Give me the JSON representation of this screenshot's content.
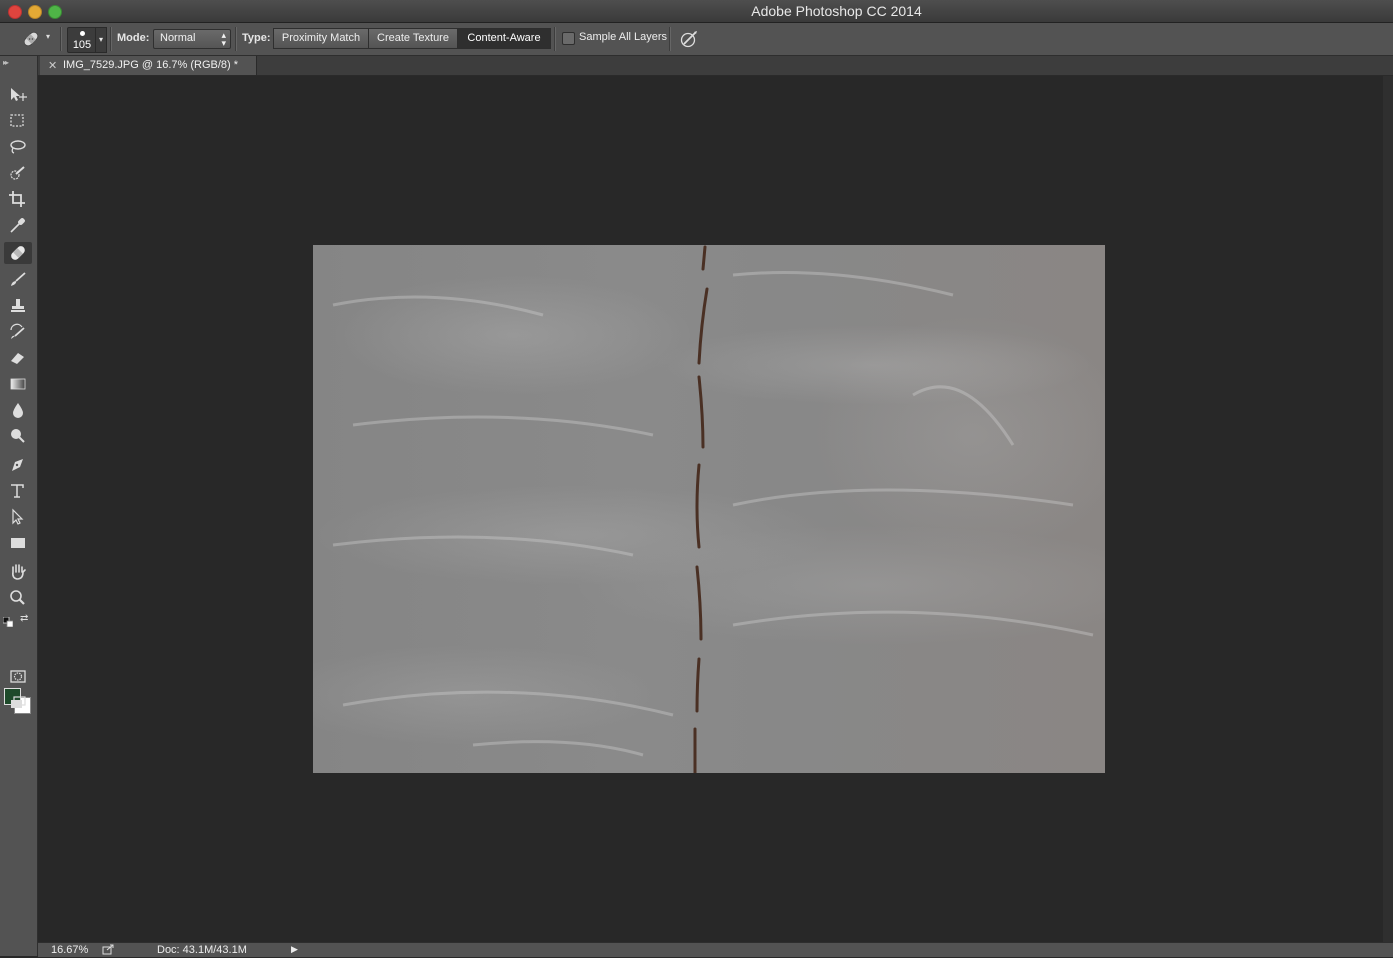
{
  "window": {
    "title": "Adobe Photoshop CC 2014"
  },
  "options_bar": {
    "brush_size": "105",
    "mode_label": "Mode:",
    "mode_value": "Normal",
    "type_label": "Type:",
    "type_options": [
      "Proximity Match",
      "Create Texture",
      "Content-Aware"
    ],
    "type_selected": "Content-Aware",
    "sample_all_layers_label": "Sample All Layers",
    "sample_all_layers_checked": false
  },
  "toolbar": {
    "active_tool": "spot-healing-brush-tool",
    "tools": [
      "move-tool-icon",
      "marquee-tool-icon",
      "lasso-tool-icon",
      "quick-selection-tool-icon",
      "crop-tool-icon",
      "eyedropper-tool-icon",
      "spot-healing-brush-tool-icon",
      "brush-tool-icon",
      "clone-stamp-tool-icon",
      "history-brush-tool-icon",
      "eraser-tool-icon",
      "gradient-tool-icon",
      "blur-tool-icon",
      "dodge-tool-icon",
      "pen-tool-icon",
      "type-tool-icon",
      "path-selection-tool-icon",
      "rectangle-tool-icon",
      "hand-tool-icon",
      "zoom-tool-icon"
    ],
    "foreground_color": "#1e4a2a",
    "background_color": "#ffffff"
  },
  "document": {
    "tab_title": "IMG_7529.JPG @ 16.7% (RGB/8) *"
  },
  "status_bar": {
    "zoom": "16.67%",
    "doc_info": "Doc: 43.1M/43.1M"
  }
}
